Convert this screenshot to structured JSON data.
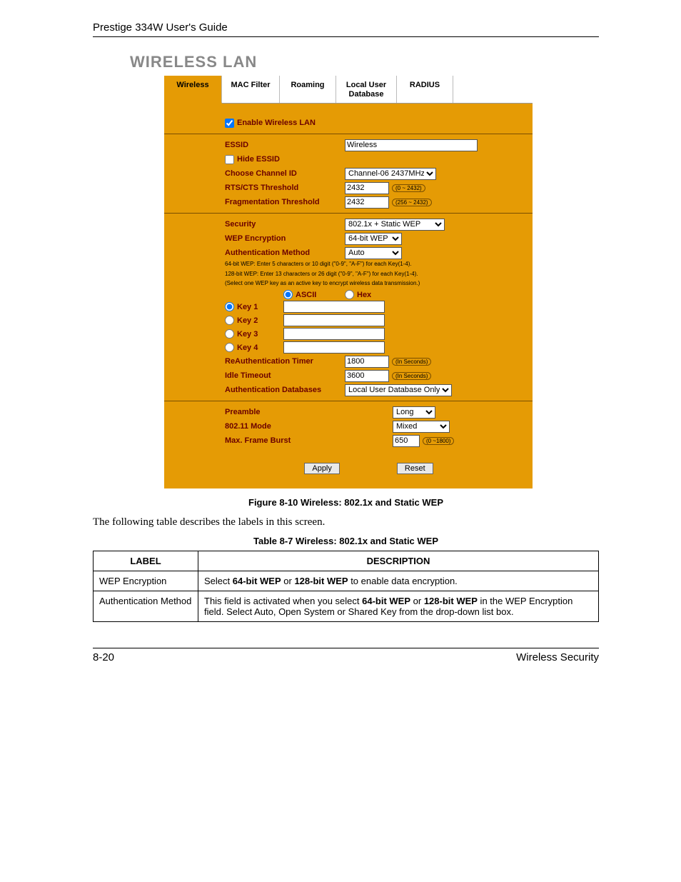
{
  "header": {
    "title": "Prestige 334W User's Guide"
  },
  "section": {
    "title": "WIRELESS LAN"
  },
  "tabs": [
    {
      "label": "Wireless",
      "active": true
    },
    {
      "label": "MAC Filter"
    },
    {
      "label": "Roaming"
    },
    {
      "label": "Local User\nDatabase"
    },
    {
      "label": "RADIUS"
    }
  ],
  "form": {
    "enable_label": "Enable Wireless LAN",
    "enable_checked": true,
    "essid_label": "ESSID",
    "essid_value": "Wireless",
    "hide_essid_label": "Hide ESSID",
    "hide_essid_checked": false,
    "channel_label": "Choose Channel ID",
    "channel_value": "Channel-06 2437MHz",
    "rts_label": "RTS/CTS Threshold",
    "rts_value": "2432",
    "rts_help": "(0 ~ 2432)",
    "frag_label": "Fragmentation Threshold",
    "frag_value": "2432",
    "frag_help": "(256 ~ 2432)",
    "security_label": "Security",
    "security_value": "802.1x + Static WEP",
    "wep_label": "WEP Encryption",
    "wep_value": "64-bit WEP",
    "auth_method_label": "Authentication Method",
    "auth_method_value": "Auto",
    "note1": "64-bit WEP: Enter 5 characters or 10 digit (\"0-9\", \"A-F\") for each Key(1-4).",
    "note2": "128-bit WEP: Enter 13 characters or 26 digit (\"0-9\", \"A-F\") for each Key(1-4).",
    "note3": "(Select one WEP key as an active key to encrypt wireless data transmission.)",
    "ascii_label": "ASCII",
    "hex_label": "Hex",
    "keys": [
      {
        "label": "Key 1",
        "selected": true
      },
      {
        "label": "Key 2"
      },
      {
        "label": "Key 3"
      },
      {
        "label": "Key 4"
      }
    ],
    "reauth_label": "ReAuthentication Timer",
    "reauth_value": "1800",
    "reauth_help": "(In Seconds)",
    "idle_label": "Idle Timeout",
    "idle_value": "3600",
    "idle_help": "(In Seconds)",
    "authdb_label": "Authentication Databases",
    "authdb_value": "Local User Database Only",
    "preamble_label": "Preamble",
    "preamble_value": "Long",
    "mode_label": "802.11 Mode",
    "mode_value": "Mixed",
    "burst_label": "Max. Frame Burst",
    "burst_value": "650",
    "burst_help": "(0 ~1800)",
    "apply": "Apply",
    "reset": "Reset"
  },
  "figure_caption": "Figure 8-10 Wireless: 802.1x and Static WEP",
  "intro_text": "The following table describes the labels in this screen.",
  "table_caption": "Table 8-7 Wireless: 802.1x and Static WEP",
  "table": {
    "head_label": "LABEL",
    "head_desc": "DESCRIPTION",
    "rows": [
      {
        "label": "WEP Encryption",
        "desc_pre": "Select ",
        "desc_b1": "64-bit WEP",
        "desc_mid1": " or ",
        "desc_b2": "128-bit WEP",
        "desc_post": " to enable data encryption."
      },
      {
        "label": "Authentication Method",
        "desc_pre": "This field is activated when you select ",
        "desc_b1": "64-bit WEP",
        "desc_mid1": " or ",
        "desc_b2": "128-bit WEP",
        "desc_post": " in the WEP Encryption field. Select Auto, Open System or Shared Key from the drop-down list box."
      }
    ]
  },
  "footer": {
    "page": "8-20",
    "section": "Wireless Security"
  }
}
